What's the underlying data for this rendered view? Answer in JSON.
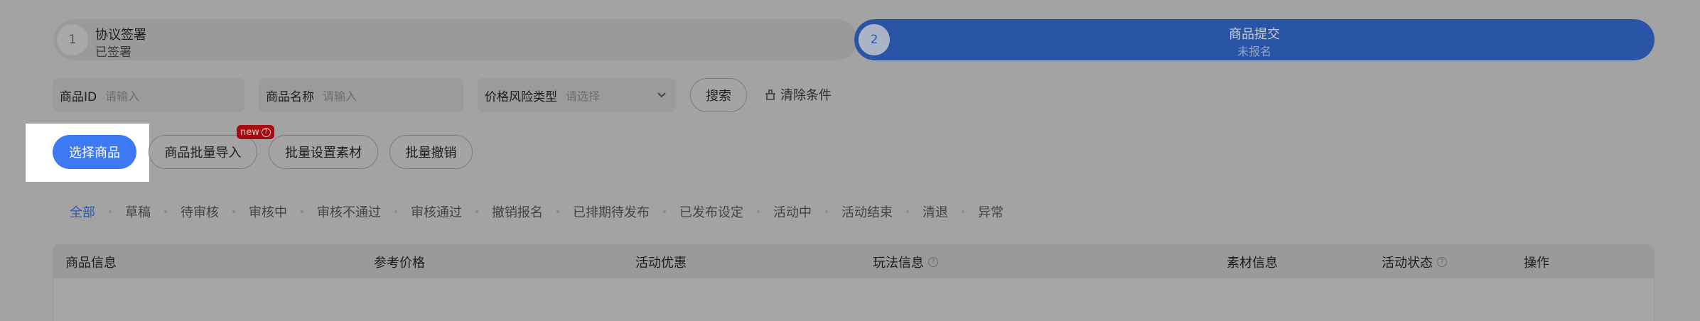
{
  "stepper": {
    "step1": {
      "number": "1",
      "title": "协议签署",
      "status": "已签署"
    },
    "step2": {
      "number": "2",
      "title": "商品提交",
      "status": "未报名"
    }
  },
  "filters": {
    "product_id": {
      "label": "商品ID",
      "placeholder": "请输入"
    },
    "product_name": {
      "label": "商品名称",
      "placeholder": "请输入"
    },
    "price_risk": {
      "label": "价格风险类型",
      "placeholder": "请选择"
    },
    "search_label": "搜索",
    "clear_label": "清除条件"
  },
  "actions": {
    "select_label": "选择商品",
    "import_label": "商品批量导入",
    "import_badge": "new",
    "material_label": "批量设置素材",
    "revoke_label": "批量撤销"
  },
  "tabs": [
    "全部",
    "草稿",
    "待审核",
    "审核中",
    "审核不通过",
    "审核通过",
    "撤销报名",
    "已排期待发布",
    "已发布设定",
    "活动中",
    "活动结束",
    "清退",
    "异常"
  ],
  "active_tab": 0,
  "table": {
    "headers": [
      "商品信息",
      "参考价格",
      "活动优惠",
      "玩法信息",
      "素材信息",
      "活动状态",
      "操作"
    ]
  },
  "colors": {
    "accent": "#3e79f4",
    "step_active": "#2a55a6",
    "badge": "#a60d12"
  }
}
